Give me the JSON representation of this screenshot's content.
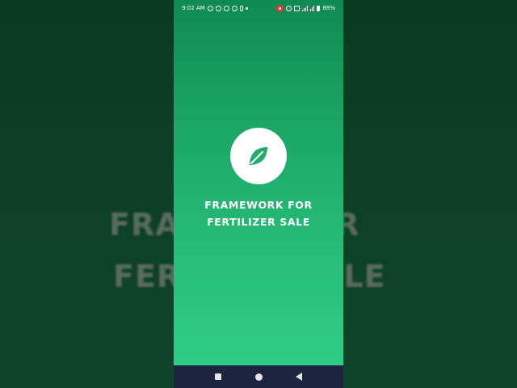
{
  "status_bar": {
    "time": "9:02 AM",
    "battery": "88%"
  },
  "app": {
    "title_line1": "FRAMEWORK FOR",
    "title_line2": "FERTILIZER SALE",
    "logo_icon": "leaf-icon",
    "accent_color": "#1aa463"
  },
  "background": {
    "text_left_1": "FRA",
    "text_left_2": "FER",
    "text_right_1": "FOR",
    "text_right_2": "ALE"
  },
  "nav_bar": {
    "recents_icon": "square-icon",
    "home_icon": "circle-icon",
    "back_icon": "triangle-back-icon"
  }
}
